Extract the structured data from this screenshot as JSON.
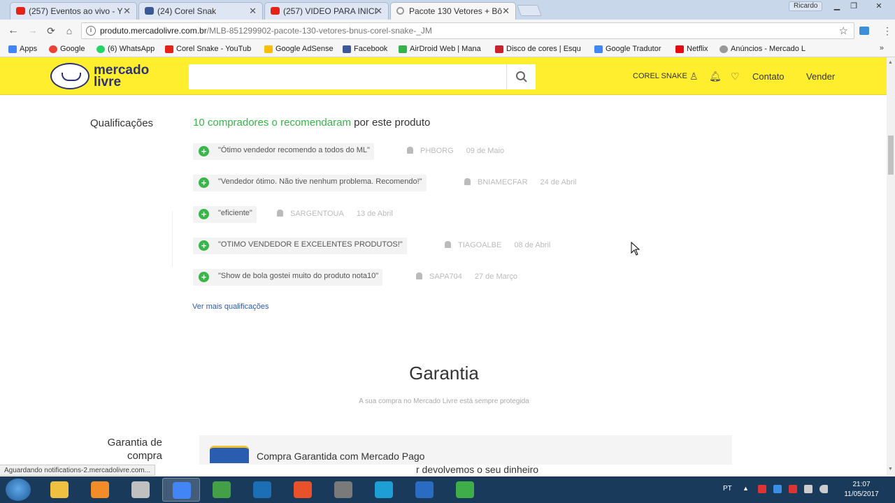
{
  "browser": {
    "tabs": [
      {
        "title": "(257) Eventos ao vivo - Y",
        "icon": "youtube-icon",
        "color": "#e62117",
        "active": false
      },
      {
        "title": "(24) Corel Snak",
        "icon": "facebook-icon",
        "color": "#3b5998",
        "active": false
      },
      {
        "title": "(257) VIDEO PARA INICI",
        "icon": "youtube-icon",
        "color": "#e62117",
        "active": false
      },
      {
        "title": "Pacote 130 Vetores + Bô",
        "icon": "loading-icon",
        "color": "#999999",
        "active": true
      }
    ],
    "profile_name": "Ricardo",
    "url_host": "produto.mercadolivre.com.br",
    "url_path": "/MLB-851299902-pacote-130-vetores-bnus-corel-snake-_JM",
    "bookmarks": [
      {
        "label": "Apps",
        "color": "#4285f4"
      },
      {
        "label": "Google",
        "color": "#ea4335"
      },
      {
        "label": "(6) WhatsApp",
        "color": "#25d366"
      },
      {
        "label": "Corel Snake - YouTub",
        "color": "#e62117"
      },
      {
        "label": "Google AdSense",
        "color": "#fbbc05"
      },
      {
        "label": "Facebook",
        "color": "#3b5998"
      },
      {
        "label": "AirDroid Web | Mana",
        "color": "#36b24a"
      },
      {
        "label": "Disco de cores | Esqu",
        "color": "#c8232c"
      },
      {
        "label": "Google Tradutor",
        "color": "#4285f4"
      },
      {
        "label": "Netflix",
        "color": "#e50914"
      },
      {
        "label": "Anúncios - Mercado L",
        "color": "#999999"
      }
    ],
    "status_text": "Aguardando notifications-2.mercadolivre.com..."
  },
  "header": {
    "logo_line1": "mercado",
    "logo_line2": "livre",
    "user": "COREL SNAKE",
    "contact": "Contato",
    "sell": "Vender"
  },
  "qualifications": {
    "label": "Qualificações",
    "count_text": "10 compradores o recomendaram",
    "suffix_text": "por este produto",
    "reviews": [
      {
        "text": "\"Ótimo vendedor recomendo a todos do ML\"",
        "user": "PHBORG",
        "date": "09 de Maio"
      },
      {
        "text": "\"Vendedor ótimo. Não tive nenhum problema. Recomendo!\"",
        "user": "BNIAMECFAR",
        "date": "24 de Abril"
      },
      {
        "text": "\"eficiente\"",
        "user": "SARGENTOUA",
        "date": "13 de Abril"
      },
      {
        "text": "\"OTIMO VENDEDOR E EXCELENTES PRODUTOS!\"",
        "user": "TIAGOALBE",
        "date": "08 de Abril"
      },
      {
        "text": "\"Show de bola gostei muito do produto nota10\"",
        "user": "SAPA704",
        "date": "27 de Março"
      }
    ],
    "more_link": "Ver mais qualificações"
  },
  "guarantee": {
    "title": "Garantia",
    "subtitle": "A sua compra no Mercado Livre está sempre protegida",
    "label": "Garantia de compra",
    "card_title": "Compra Garantida com Mercado Pago",
    "card_body": "r devolvemos o seu dinheiro"
  },
  "taskbar": {
    "apps": [
      {
        "name": "explorer",
        "color": "#f0c040"
      },
      {
        "name": "media-player",
        "color": "#f28c28"
      },
      {
        "name": "screen-recorder",
        "color": "#c0c0c0"
      },
      {
        "name": "chrome",
        "color": "#4285f4"
      },
      {
        "name": "coreldraw",
        "color": "#44a047"
      },
      {
        "name": "photoshop",
        "color": "#1c6fb5"
      },
      {
        "name": "camtasia",
        "color": "#e8512a"
      },
      {
        "name": "settings-tool",
        "color": "#7a7a7a"
      },
      {
        "name": "corel-capture",
        "color": "#1d9fd6"
      },
      {
        "name": "vegas",
        "color": "#2a6cc1"
      },
      {
        "name": "corel-connect",
        "color": "#3fae49"
      }
    ],
    "language": "PT",
    "time": "21:07",
    "date": "11/05/2017"
  }
}
